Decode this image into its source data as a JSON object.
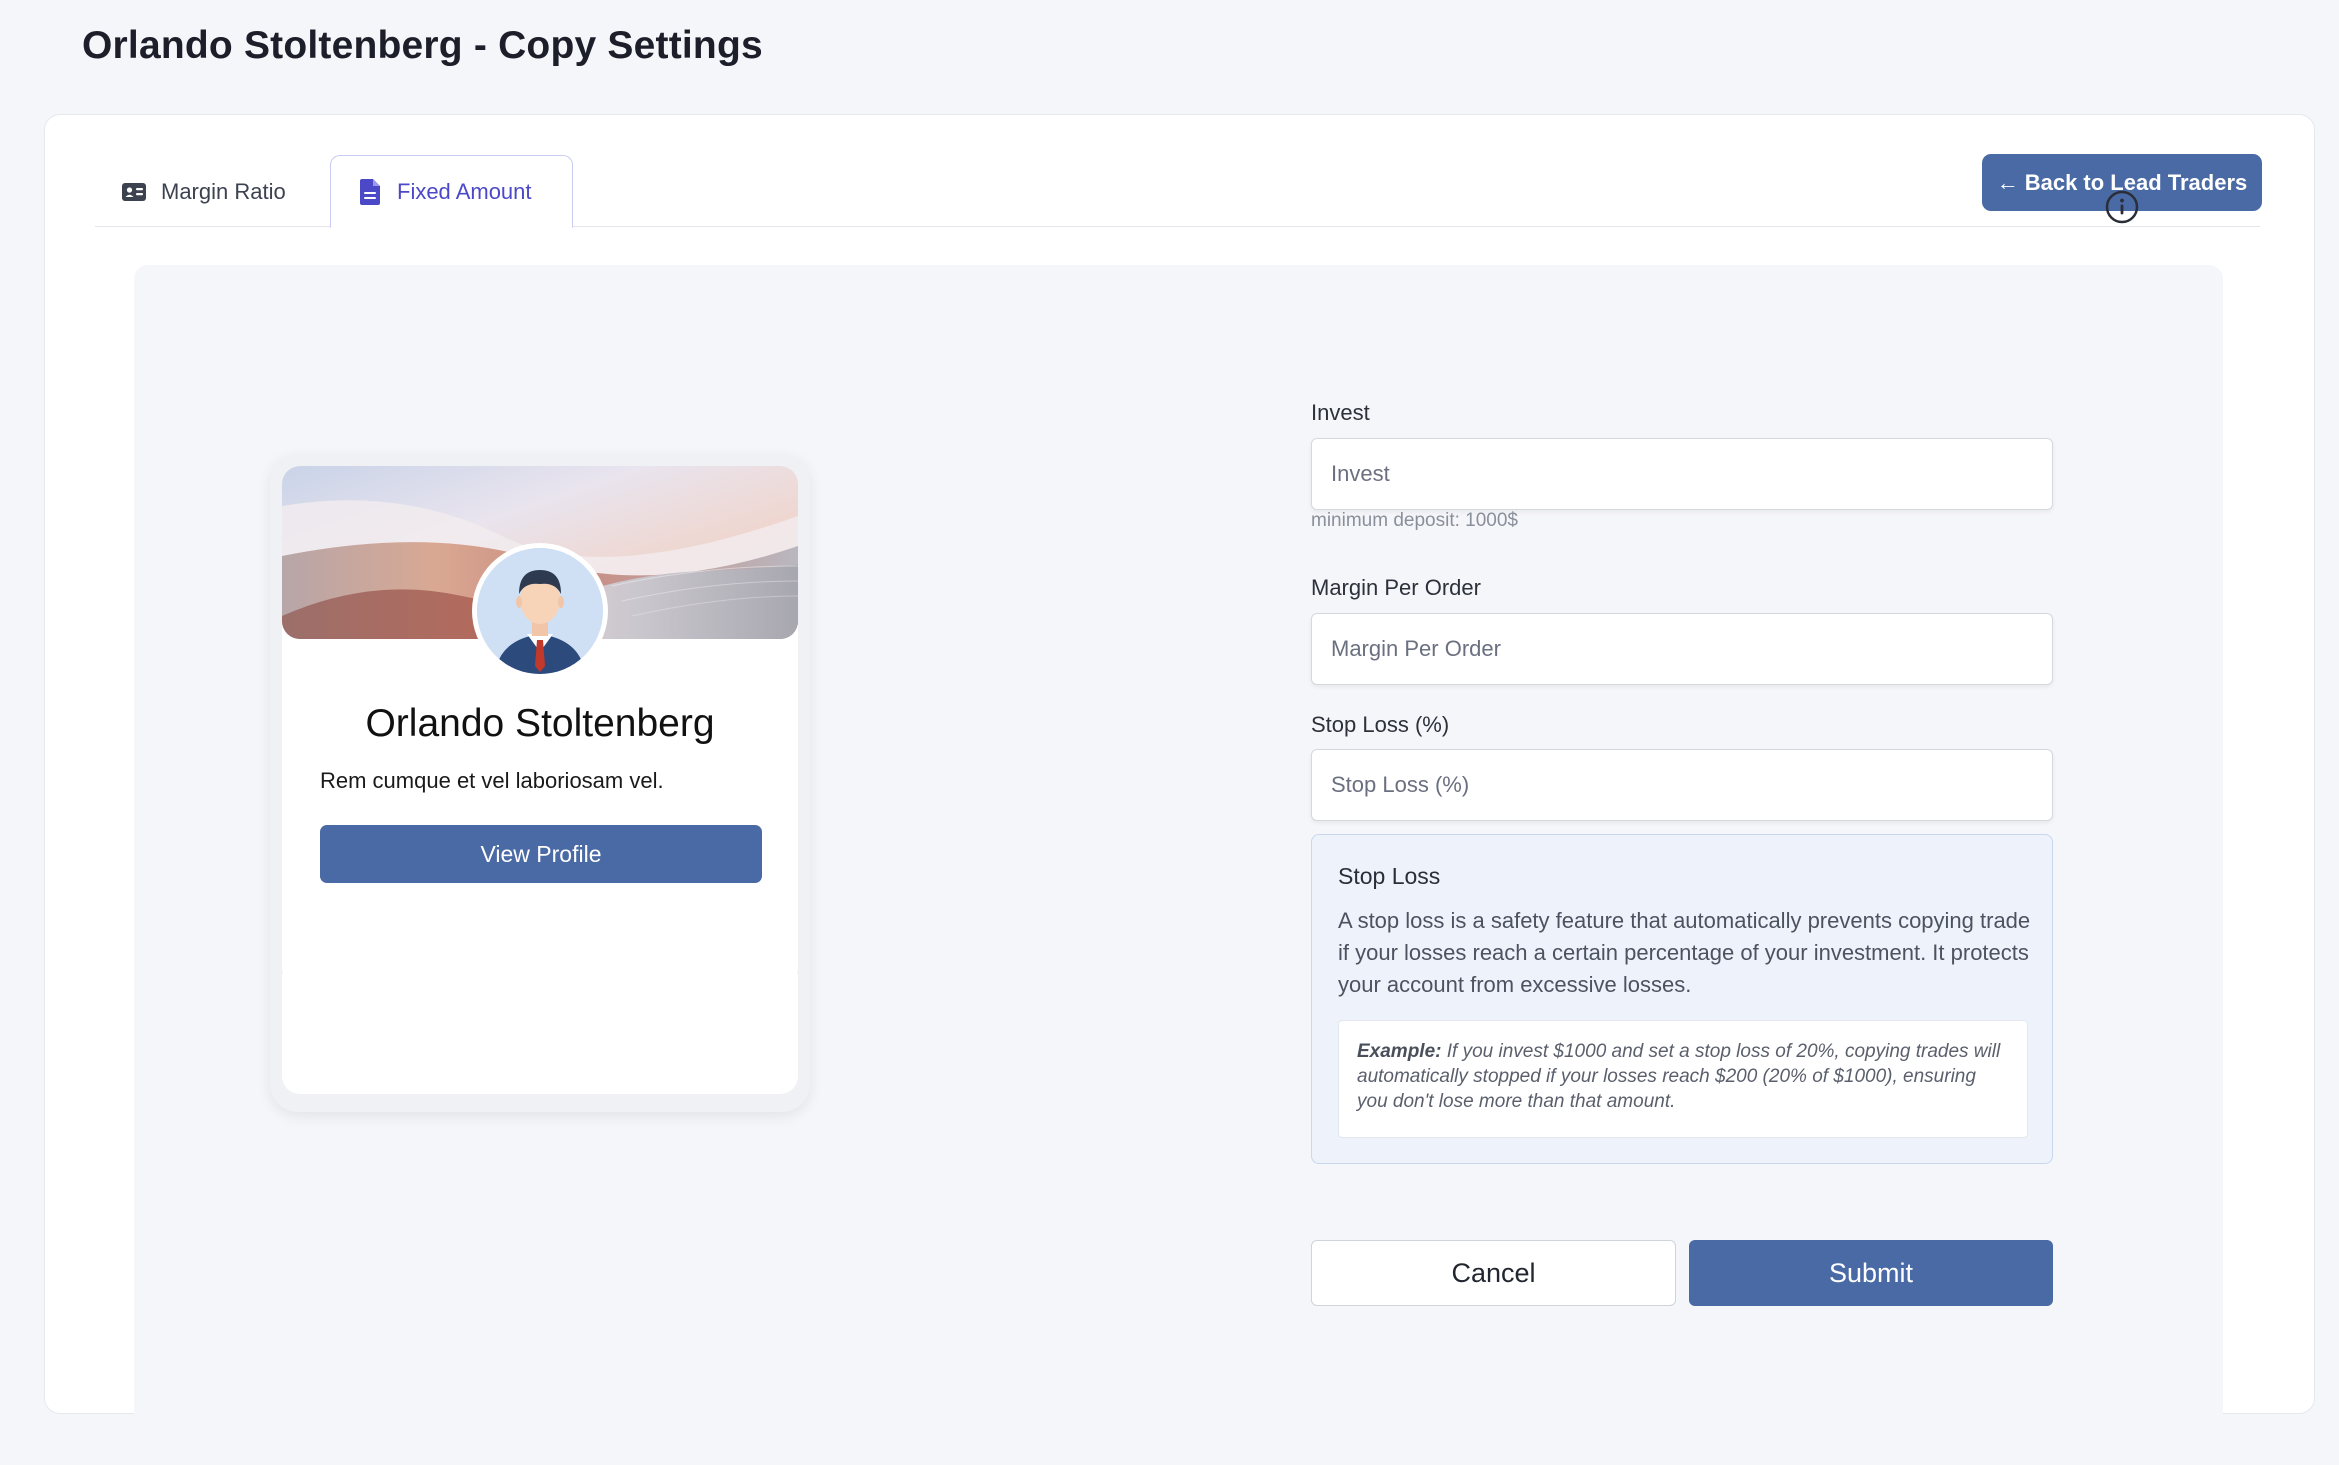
{
  "page": {
    "title": "Orlando Stoltenberg - Copy Settings"
  },
  "tabs": [
    {
      "label": "Margin Ratio",
      "icon": "id-card-icon",
      "active": false
    },
    {
      "label": "Fixed Amount",
      "icon": "document-icon",
      "active": true
    }
  ],
  "header": {
    "back_label": "Back to Lead Traders",
    "back_icon": "arrow-left-icon"
  },
  "profile": {
    "name": "Orlando Stoltenberg",
    "bio": "Rem cumque et vel laboriosam vel.",
    "view_profile_label": "View Profile"
  },
  "form": {
    "invest": {
      "label": "Invest",
      "placeholder": "Invest",
      "value": "",
      "hint": "minimum deposit: 1000$"
    },
    "margin_per_order": {
      "label": "Margin Per Order",
      "placeholder": "Margin Per Order",
      "value": ""
    },
    "stop_loss": {
      "label": "Stop Loss (%)",
      "placeholder": "Stop Loss (%)",
      "value": ""
    },
    "stop_loss_info": {
      "title": "Stop Loss",
      "description": "A stop loss is a safety feature that automatically prevents copying trade if your losses reach a certain percentage of your investment. It protects your account from excessive losses.",
      "example_label": "Example:",
      "example_text": "If you invest $1000 and set a stop loss of 20%, copying trades will automatically stopped if your losses reach $200 (20% of $1000), ensuring you don't lose more than that amount."
    },
    "cancel_label": "Cancel",
    "submit_label": "Submit"
  },
  "colors": {
    "primary": "#4a6aa5",
    "active_tab": "#4c49c8",
    "info_bg": "#eef3fb",
    "panel_bg": "#f5f6f9"
  }
}
